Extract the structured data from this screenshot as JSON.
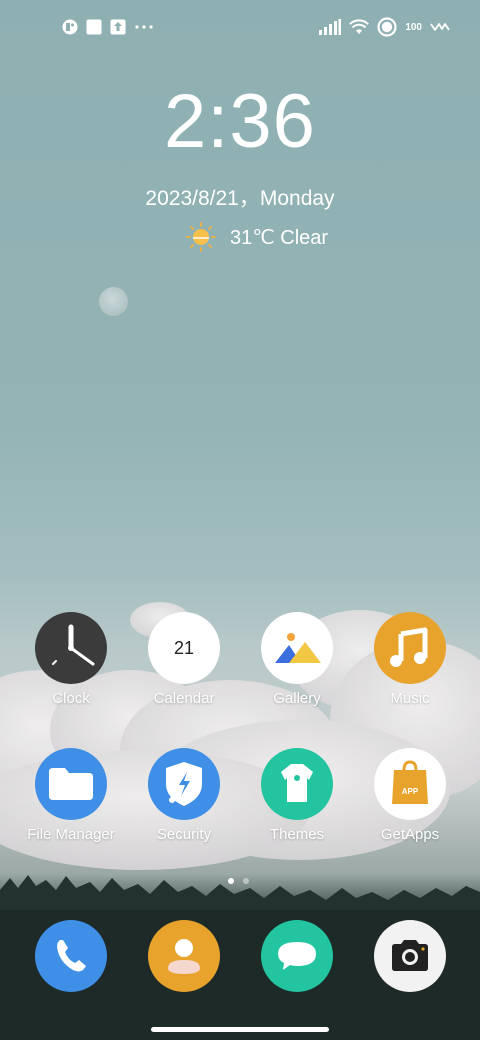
{
  "status_bar": {
    "left_icons": [
      "notification-app-icon",
      "square-notification-icon",
      "upload-icon",
      "more-dots-icon"
    ],
    "right_icons": [
      "signal-icon",
      "wifi-icon",
      "circle-status-icon"
    ],
    "battery": "100"
  },
  "clock": {
    "time": "2:36"
  },
  "date": {
    "text": "2023/8/21，Monday"
  },
  "weather": {
    "text": "31℃ Clear",
    "icon": "sun-icon"
  },
  "apps": [
    {
      "label": "Clock",
      "icon": "clock-icon",
      "color": "#3b3b3b"
    },
    {
      "label": "Calendar",
      "icon": "calendar-icon",
      "day": "21",
      "color": "#ffffff"
    },
    {
      "label": "Gallery",
      "icon": "gallery-icon",
      "color": "#ffffff"
    },
    {
      "label": "Music",
      "icon": "music-note-icon",
      "color": "#e8a32c"
    },
    {
      "label": "File Manager",
      "icon": "folder-icon",
      "color": "#3f8fe6"
    },
    {
      "label": "Security",
      "icon": "shield-icon",
      "color": "#3f8fe6"
    },
    {
      "label": "Themes",
      "icon": "themes-icon",
      "color": "#23c4a0"
    },
    {
      "label": "GetApps",
      "icon": "shopping-bag-icon",
      "badge": "APP",
      "color": "#ffffff"
    }
  ],
  "page_indicator": {
    "pages": 2,
    "current": 1
  },
  "dock": [
    {
      "icon": "phone-icon",
      "color": "#3f8fe6"
    },
    {
      "icon": "contacts-icon",
      "color": "#e8a32c"
    },
    {
      "icon": "messages-icon",
      "color": "#23c4a0"
    },
    {
      "icon": "camera-icon",
      "color": "#f2f2f2"
    }
  ]
}
